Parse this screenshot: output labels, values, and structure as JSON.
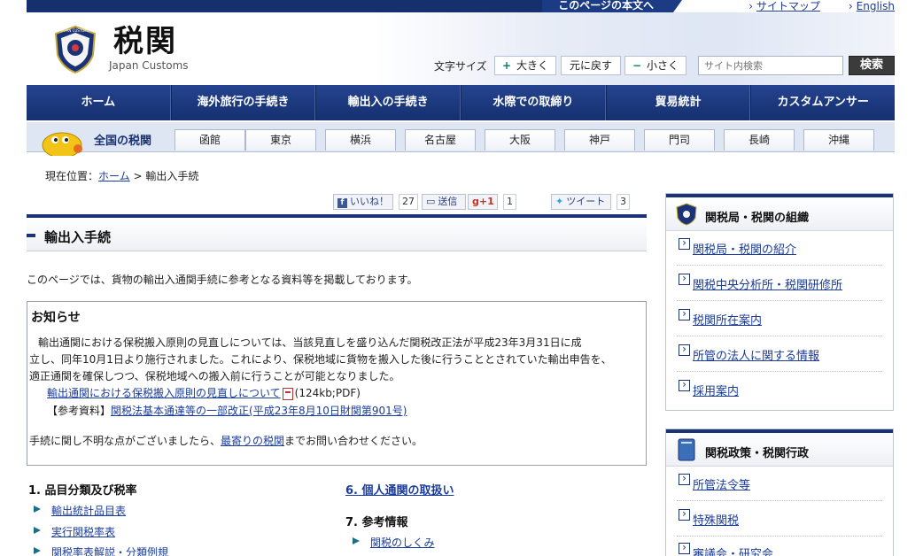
{
  "skip_bar": {
    "label": "このページの本文へ"
  },
  "top_links": {
    "sitemap": "サイトマップ",
    "english": "English"
  },
  "header": {
    "title": "税関",
    "subtitle": "Japan Customs",
    "emblem_text": "JAPAN CUSTOMS",
    "font_size_label": "文字サイズ",
    "font_larger": "大きく",
    "font_reset": "元に戻す",
    "font_smaller": "小さく",
    "search_placeholder": "サイト内検索",
    "search_button": "検索"
  },
  "main_nav": [
    "ホーム",
    "海外旅行の手続き",
    "輸出入の手続き",
    "水際での取締り",
    "貿易統計",
    "カスタムアンサー"
  ],
  "region_nav": {
    "label": "全国の税関",
    "items": [
      "函館",
      "東京",
      "横浜",
      "名古屋",
      "大阪",
      "神戸",
      "門司",
      "長崎",
      "沖縄"
    ]
  },
  "breadcrumb": {
    "prefix": "現在位置：",
    "home": "ホーム",
    "sep": " > ",
    "current": "輸出入手続"
  },
  "social": {
    "like": "いいね！",
    "like_count": "27",
    "send": "送信",
    "gplus": "+1",
    "gplus_count": "1",
    "tweet": "ツイート",
    "tweet_count": "3"
  },
  "page": {
    "heading": "輸出入手続",
    "intro": "このページでは、貨物の輸出入通関手続に参考となる資料等を掲載しております。"
  },
  "notice": {
    "title": "お知らせ",
    "line1": "輸出通関における保税搬入原則の見直しについては、当該見直しを盛り込んだ関税改正法が平成23年3月31日に成",
    "line2": "立し、同年10月1日より施行されました。これにより、保税地域に貨物を搬入した後に行うこととされていた輸出申告を、",
    "line3": "適正通関を確保しつつ、保税地域への搬入前に行うことが可能となりました。",
    "link1": "輸出通関における保税搬入原則の見直しについて",
    "link1_suffix": "(124kb;PDF)",
    "ref_prefix": "【参考資料】",
    "ref_link": "関税法基本通達等の一部改正(平成23年8月10日財関第901号)",
    "contact_pre": "手続に関し不明な点がございましたら、",
    "contact_link": "最寄りの税関",
    "contact_post": "までお問い合わせください。"
  },
  "sections": {
    "s1": {
      "heading": "1. 品目分類及び税率",
      "items": [
        "輸出統計品目表",
        "実行関税率表",
        "関税率表解説・分類例規"
      ]
    },
    "s6": {
      "heading": "6. 個人通関の取扱い"
    },
    "s7": {
      "heading": "7. 参考情報",
      "items": [
        "関税のしくみ"
      ]
    }
  },
  "sidebar": {
    "box1": {
      "title": "関税局・税関の組織",
      "links": [
        "関税局・税関の紹介",
        "関税中央分析所・税関研修所",
        "税関所在案内",
        "所管の法人に関する情報",
        "採用案内"
      ]
    },
    "box2": {
      "title": "関税政策・税関行政",
      "links": [
        "所管法令等",
        "特殊関税",
        "審議会・研究会"
      ]
    }
  }
}
